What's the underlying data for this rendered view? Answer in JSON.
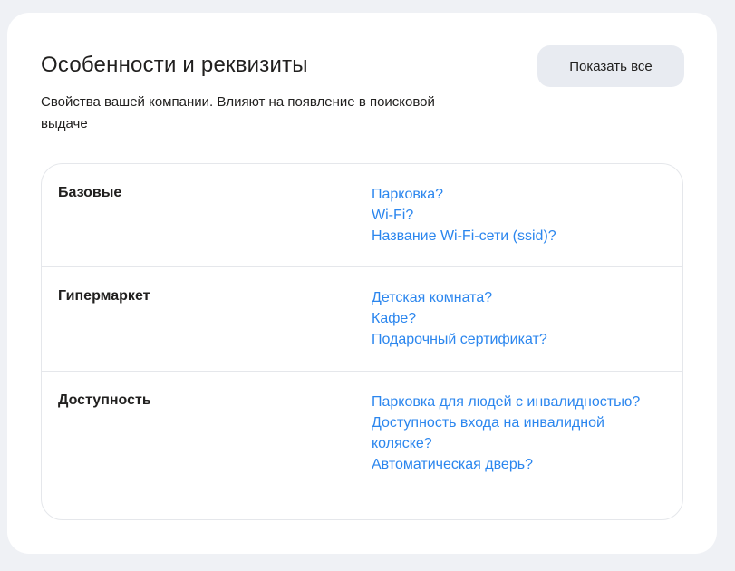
{
  "section": {
    "title": "Особенности и реквизиты",
    "subtitle": "Свойства вашей компании. Влияют на появление в поисковой выдаче",
    "show_all_label": "Показать все"
  },
  "groups": [
    {
      "label": "Базовые",
      "items": [
        "Парковка?",
        "Wi-Fi?",
        "Название Wi-Fi-сети (ssid)?"
      ]
    },
    {
      "label": "Гипермаркет",
      "items": [
        "Детская комната?",
        "Кафе?",
        "Подарочный сертификат?"
      ]
    },
    {
      "label": "Доступность",
      "items": [
        "Парковка для людей с инвалидностью?",
        "Доступность входа на инвалидной коляске?",
        "Автоматическая дверь?"
      ]
    }
  ],
  "colors": {
    "link": "#2b86ee",
    "background": "#eff1f5",
    "card": "#ffffff",
    "button_bg": "#e8ebf1",
    "text": "#21201f"
  }
}
